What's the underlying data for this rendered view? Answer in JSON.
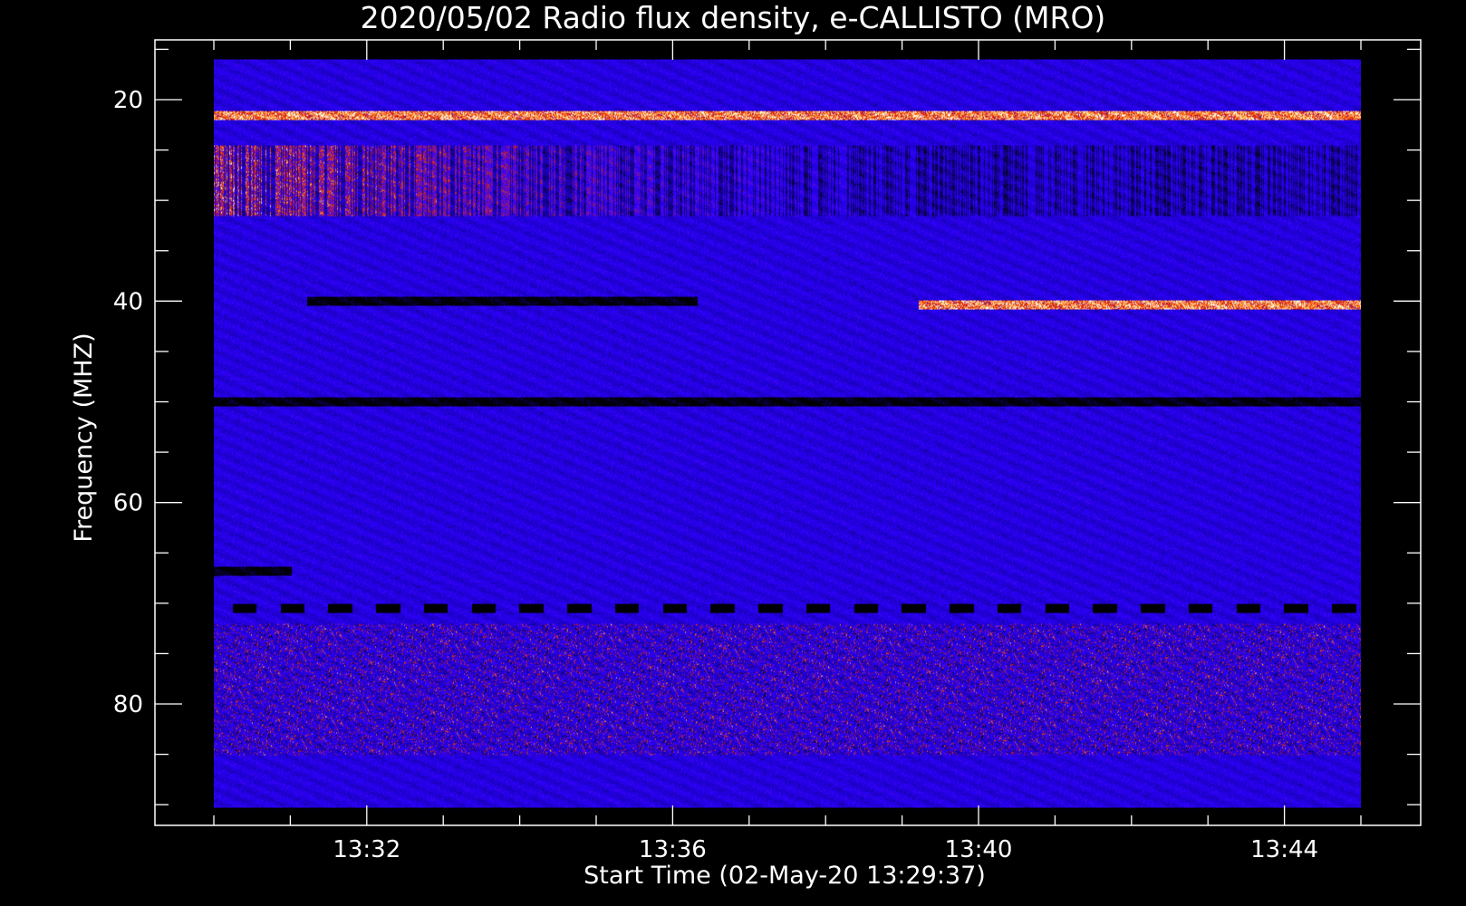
{
  "chart_data": {
    "type": "heatmap",
    "title": "2020/05/02  Radio flux density, e-CALLISTO (MRO)",
    "xlabel": "Start Time (02-May-20 13:29:37)",
    "ylabel": "Frequency (MHZ)",
    "x_axis": {
      "range_minutes": [
        "13:29:37",
        "13:45:00"
      ],
      "tick_labels": [
        "13:32",
        "13:36",
        "13:40",
        "13:44"
      ],
      "tick_minutes": [
        2.383,
        6.383,
        10.383,
        14.383
      ],
      "minor_tick_step_minutes": 1,
      "ticks_start_minute": 0.383
    },
    "y_axis": {
      "range": [
        14,
        91.5
      ],
      "inverted": true,
      "tick_labels": [
        "20",
        "40",
        "60",
        "80"
      ],
      "tick_values": [
        20,
        40,
        60,
        80
      ],
      "minor_ticks": [
        15,
        25,
        30,
        35,
        45,
        50,
        55,
        65,
        70,
        75,
        85,
        90
      ]
    },
    "data_extent": {
      "time_minutes": [
        0.383,
        15.383
      ],
      "frequency_mhz": [
        16,
        90.3
      ]
    },
    "colormap": [
      "#000000",
      "#1a00b4",
      "#2a00ff",
      "#6010d0",
      "#c01820",
      "#ff5000",
      "#ffd060",
      "#ffffff"
    ],
    "background_level": "blue",
    "features": [
      {
        "label": "bright band",
        "frequency_mhz": 21.5,
        "level": "high"
      },
      {
        "label": "bursty band",
        "frequency_mhz_range": [
          24.5,
          31.5
        ],
        "level": "high"
      },
      {
        "label": "dark line",
        "frequency_mhz": 40,
        "time_minutes": [
          1.6,
          6.7
        ],
        "level": "low"
      },
      {
        "label": "red line",
        "frequency_mhz": 40.3,
        "time_minutes": [
          9.6,
          15.383
        ],
        "level": "high"
      },
      {
        "label": "dark band",
        "frequency_mhz": 50,
        "level": "low"
      },
      {
        "label": "dark line",
        "frequency_mhz": 66.8,
        "time_minutes": [
          0.383,
          1.4
        ],
        "level": "low"
      },
      {
        "label": "dashed dark band",
        "frequency_mhz": 70.5,
        "level": "low"
      },
      {
        "label": "red speckled region",
        "frequency_mhz_range": [
          72,
          85
        ],
        "level": "medium"
      }
    ]
  }
}
